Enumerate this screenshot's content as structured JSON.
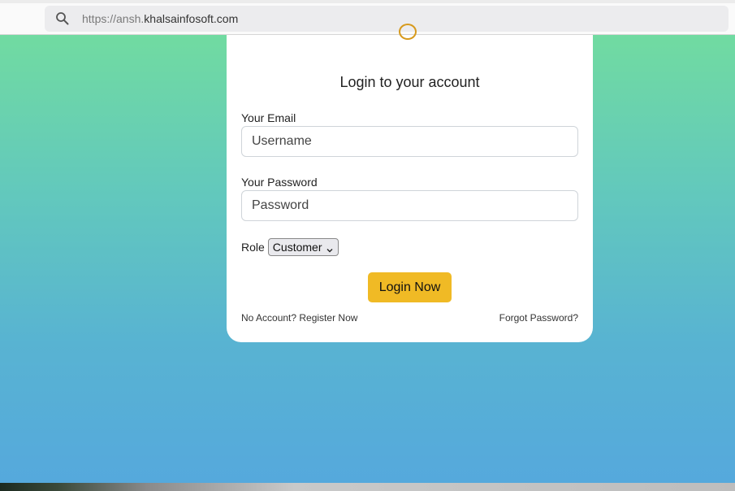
{
  "browser": {
    "url_prefix": "https://ansh.",
    "url_domain": "khalsainfosoft.com",
    "search_icon": "search-icon"
  },
  "login": {
    "title": "Login to your account",
    "email_label": "Your Email",
    "email_placeholder": "Username",
    "password_label": "Your Password",
    "password_placeholder": "Password",
    "role_label": "Role",
    "role_selected": "Customer",
    "login_button": "Login Now",
    "register_link": "No Account? Register Now",
    "forgot_link": "Forgot Password?"
  },
  "colors": {
    "gradient_top": "#74df9b",
    "gradient_bottom": "#55a8dd",
    "button": "#f0ba25",
    "logo": "#d79a1d"
  }
}
